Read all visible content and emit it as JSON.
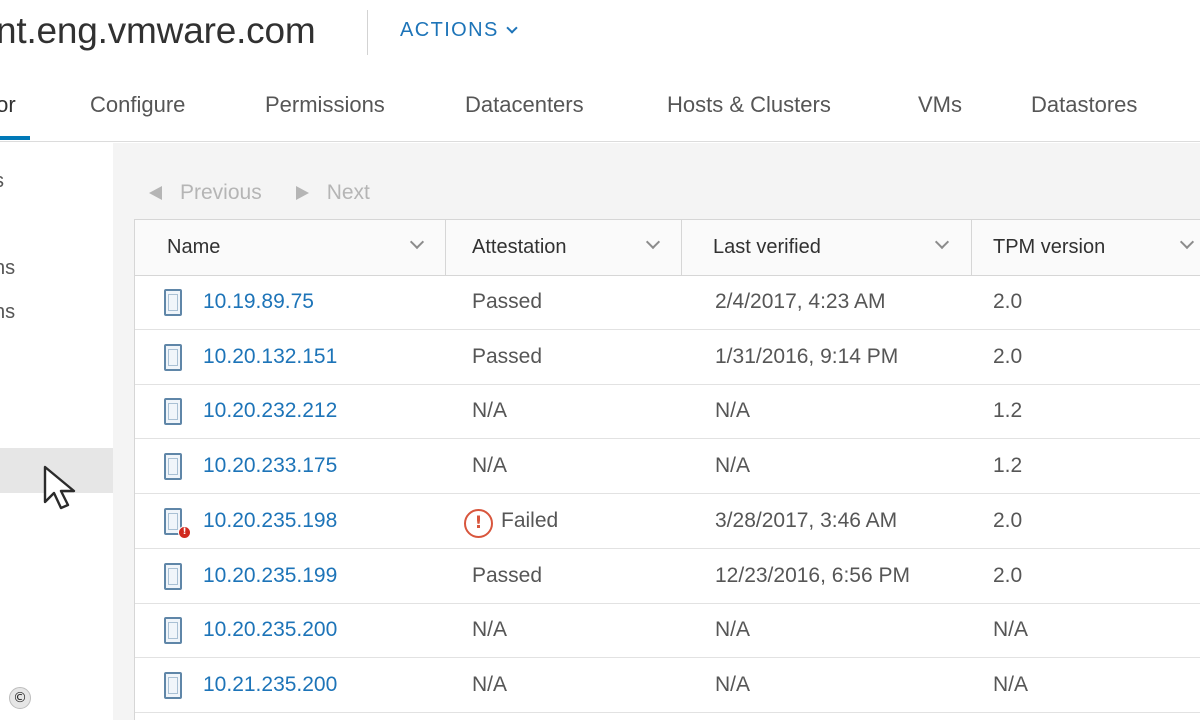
{
  "header": {
    "title": "nt.eng.vmware.com",
    "actions_label": "ACTIONS"
  },
  "tabs": [
    {
      "label": "tor",
      "active": true
    },
    {
      "label": "Configure"
    },
    {
      "label": "Permissions"
    },
    {
      "label": "Datacenters"
    },
    {
      "label": "Hosts & Clusters"
    },
    {
      "label": "VMs"
    },
    {
      "label": "Datastores"
    }
  ],
  "left_panel": {
    "items": [
      "s",
      "ns",
      "ns"
    ]
  },
  "pager": {
    "previous_label": "Previous",
    "next_label": "Next"
  },
  "table": {
    "columns": [
      "Name",
      "Attestation",
      "Last verified",
      "TPM version"
    ],
    "rows": [
      {
        "name": "10.19.89.75",
        "attestation": "Passed",
        "last_verified": "2/4/2017, 4:23 AM",
        "tpm_version": "2.0",
        "error": false
      },
      {
        "name": "10.20.132.151",
        "attestation": "Passed",
        "last_verified": "1/31/2016, 9:14 PM",
        "tpm_version": "2.0",
        "error": false
      },
      {
        "name": "10.20.232.212",
        "attestation": "N/A",
        "last_verified": "N/A",
        "tpm_version": "1.2",
        "error": false
      },
      {
        "name": "10.20.233.175",
        "attestation": "N/A",
        "last_verified": "N/A",
        "tpm_version": "1.2",
        "error": false
      },
      {
        "name": "10.20.235.198",
        "attestation": "Failed",
        "last_verified": "3/28/2017, 3:46 AM",
        "tpm_version": "2.0",
        "error": true
      },
      {
        "name": "10.20.235.199",
        "attestation": "Passed",
        "last_verified": "12/23/2016, 6:56 PM",
        "tpm_version": "2.0",
        "error": false
      },
      {
        "name": "10.20.235.200",
        "attestation": "N/A",
        "last_verified": "N/A",
        "tpm_version": "N/A",
        "error": false
      },
      {
        "name": "10.21.235.200",
        "attestation": "N/A",
        "last_verified": "N/A",
        "tpm_version": "N/A",
        "error": false
      }
    ]
  },
  "icons": {
    "host": "host-icon",
    "error": "error-badge-icon",
    "failed": "exclamation-circle-icon",
    "cursor": "mouse-pointer-icon"
  },
  "colors": {
    "link": "#1d74b8",
    "active_tab": "#0079b8",
    "error": "#d12a1f",
    "failed": "#d8563d"
  },
  "watermark": "©"
}
